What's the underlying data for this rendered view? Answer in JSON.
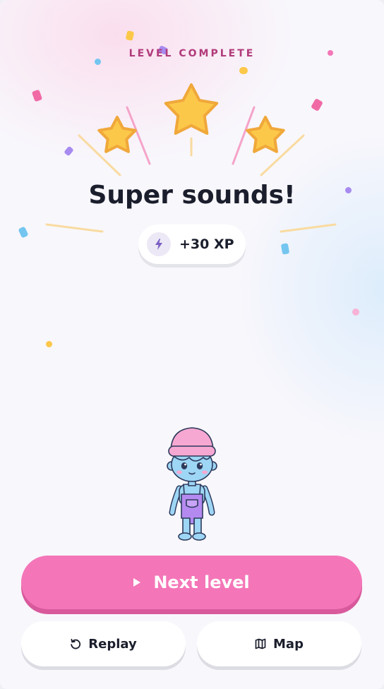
{
  "header": {
    "eyebrow": "LEVEL COMPLETE"
  },
  "result": {
    "title": "Super sounds!",
    "stars_earned": 3,
    "stars_total": 3
  },
  "reward": {
    "xp_label": "+30 XP",
    "icon": "lightning-icon"
  },
  "actions": {
    "next_label": "Next level",
    "replay_label": "Replay",
    "map_label": "Map"
  },
  "colors": {
    "accent_pink": "#f476b8",
    "eyebrow": "#b13a7a",
    "star_fill": "#fcc84a",
    "star_outline": "#f0a83a",
    "text_dark": "#1b1e2c"
  }
}
